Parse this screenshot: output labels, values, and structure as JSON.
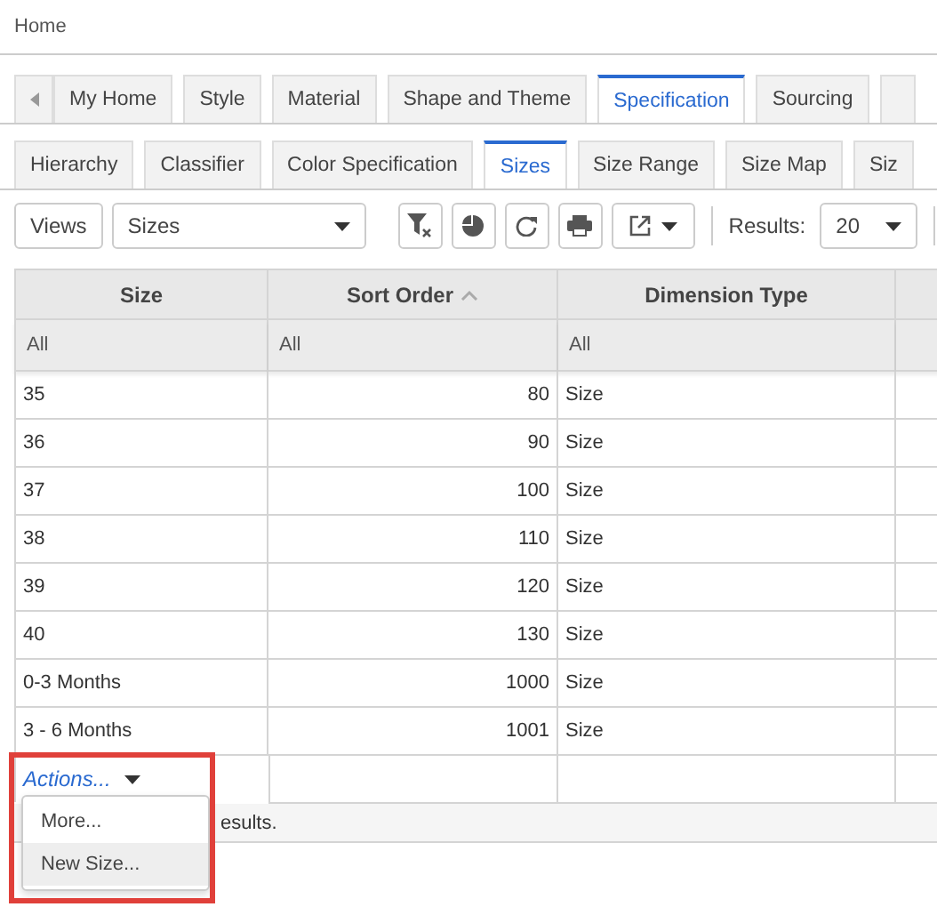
{
  "breadcrumb": "Home",
  "main_tabs": [
    {
      "label": "My Home",
      "selected": false
    },
    {
      "label": "Style",
      "selected": false
    },
    {
      "label": "Material",
      "selected": false
    },
    {
      "label": "Shape and Theme",
      "selected": false
    },
    {
      "label": "Specification",
      "selected": true
    },
    {
      "label": "Sourcing",
      "selected": false
    }
  ],
  "sub_tabs": [
    {
      "label": "Hierarchy",
      "selected": false
    },
    {
      "label": "Classifier",
      "selected": false
    },
    {
      "label": "Color Specification",
      "selected": false
    },
    {
      "label": "Sizes",
      "selected": true
    },
    {
      "label": "Size Range",
      "selected": false
    },
    {
      "label": "Size Map",
      "selected": false
    },
    {
      "label": "Siz",
      "selected": false
    }
  ],
  "toolbar": {
    "views_button": "Views",
    "view_select": "Sizes",
    "results_label": "Results:",
    "results_select": "20"
  },
  "table": {
    "columns": [
      {
        "label": "Size",
        "sorted": false
      },
      {
        "label": "Sort Order",
        "sorted": true
      },
      {
        "label": "Dimension Type",
        "sorted": false
      }
    ],
    "filters": [
      "All",
      "All",
      "All"
    ],
    "rows": [
      [
        "35",
        "80",
        "Size"
      ],
      [
        "36",
        "90",
        "Size"
      ],
      [
        "37",
        "100",
        "Size"
      ],
      [
        "38",
        "110",
        "Size"
      ],
      [
        "39",
        "120",
        "Size"
      ],
      [
        "40",
        "130",
        "Size"
      ],
      [
        "0-3 Months",
        "1000",
        "Size"
      ],
      [
        "3 - 6 Months",
        "1001",
        "Size"
      ]
    ]
  },
  "actions": {
    "label": "Actions...",
    "menu": [
      {
        "label": "More...",
        "selected": false
      },
      {
        "label": "New Size...",
        "selected": true
      }
    ]
  },
  "status": "esults."
}
